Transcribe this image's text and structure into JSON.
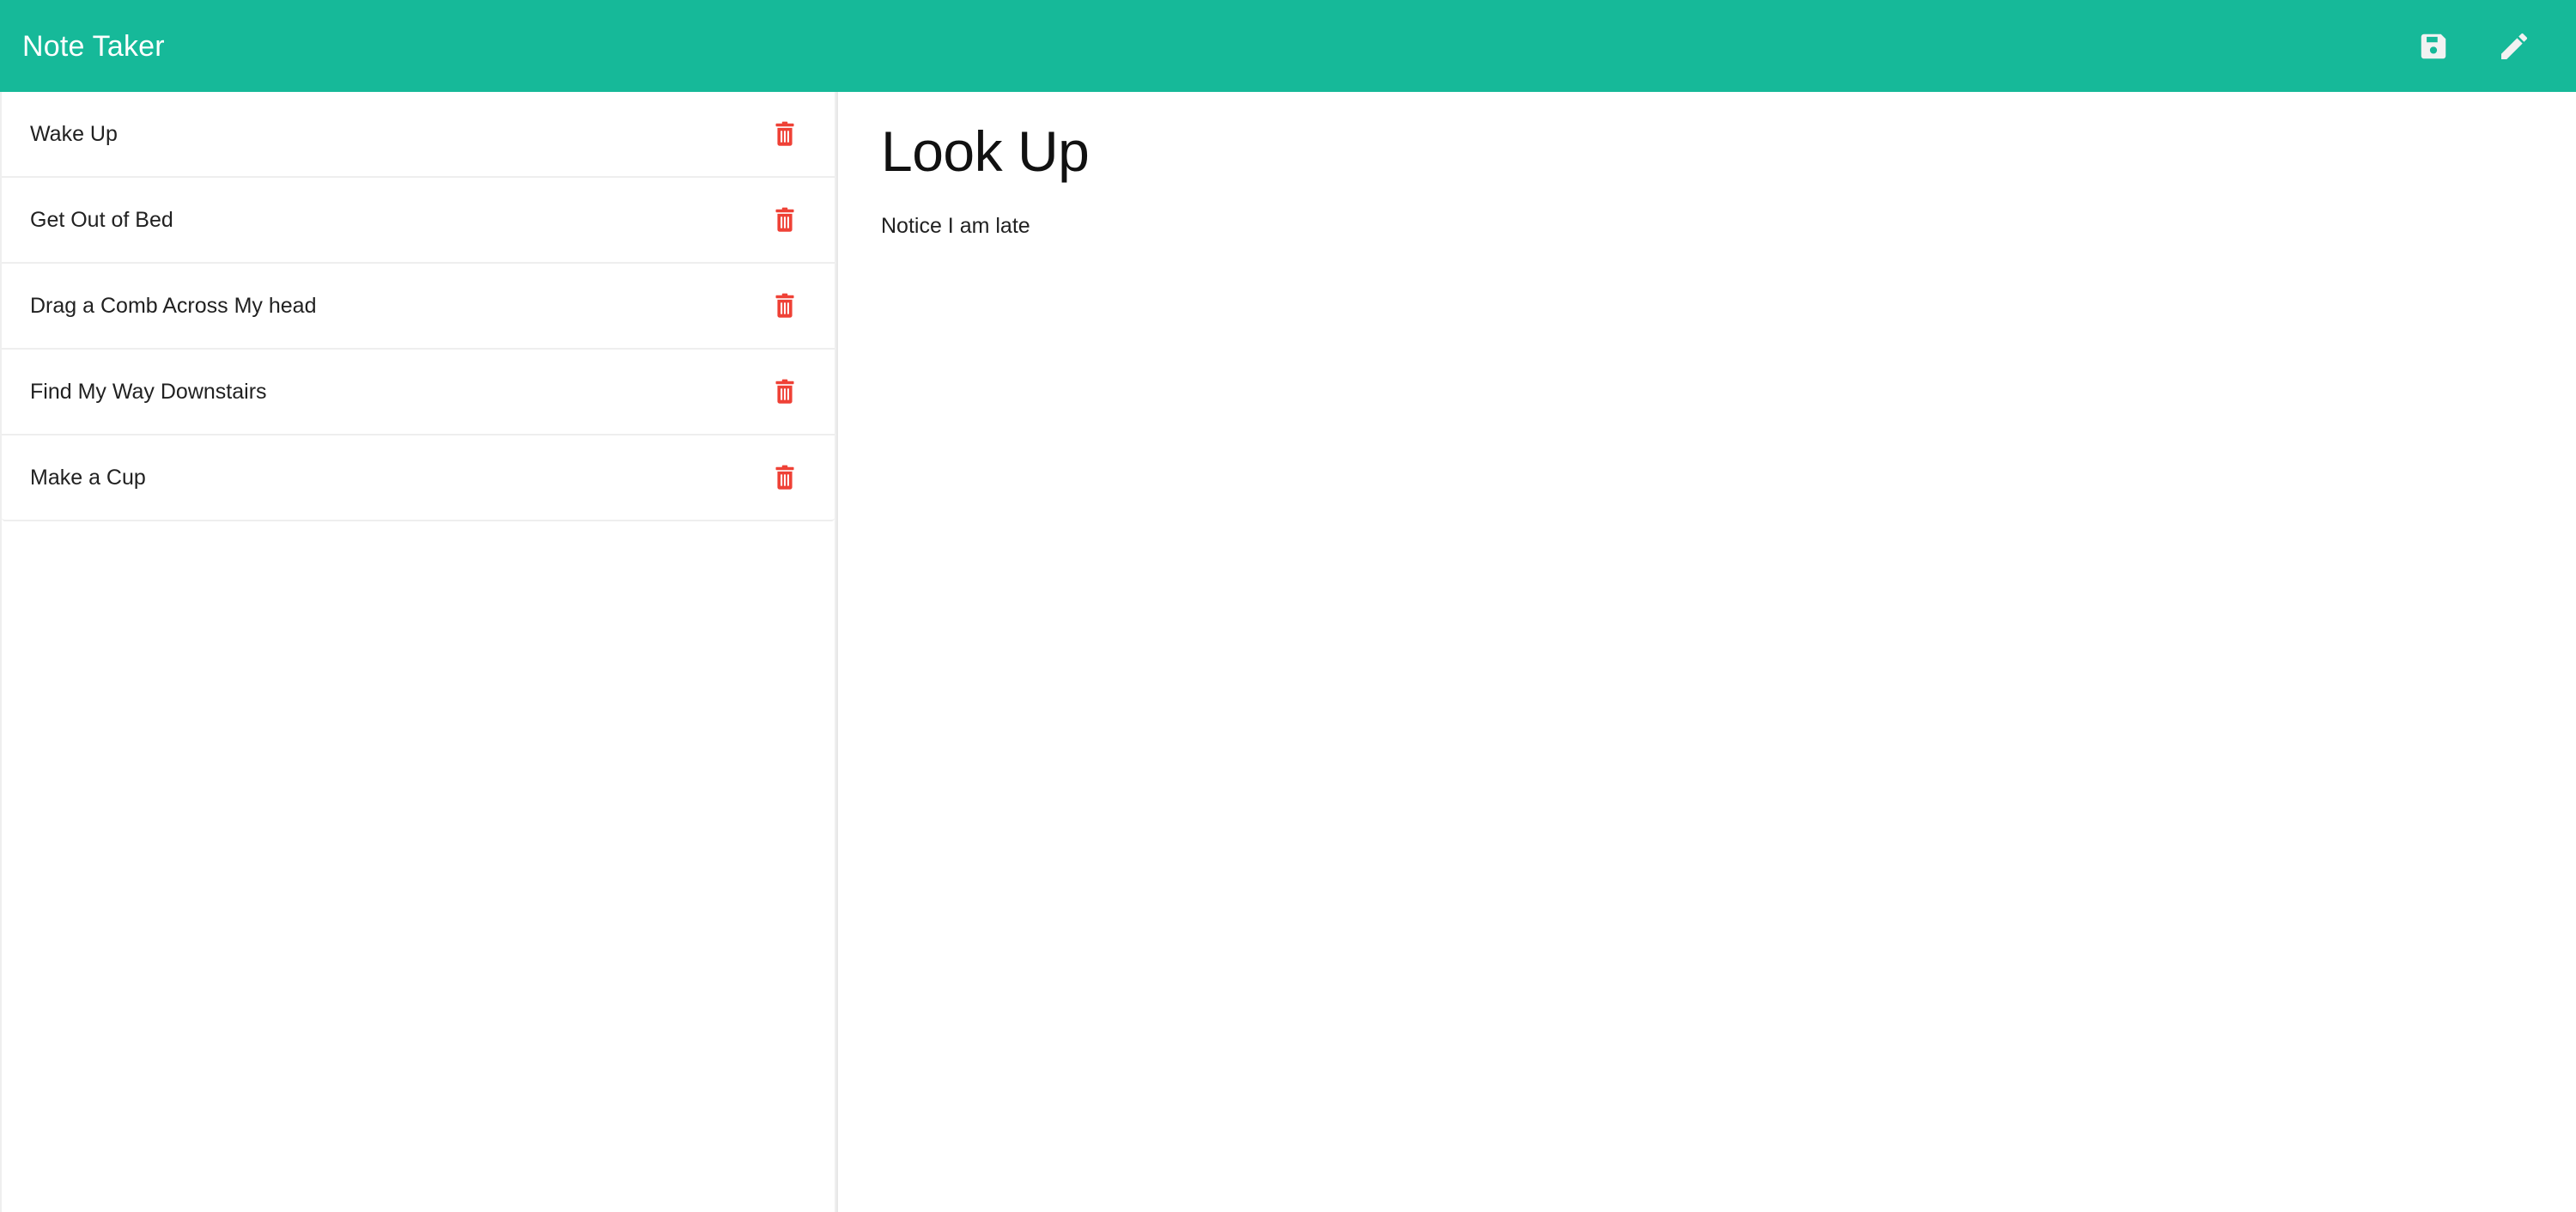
{
  "header": {
    "title": "Note Taker",
    "brand_color": "#16b999",
    "title_color": "#ffffff",
    "actions": [
      {
        "name": "save-button",
        "icon": "save-icon",
        "label": "Save"
      },
      {
        "name": "edit-button",
        "icon": "pencil-icon",
        "label": "Edit"
      }
    ]
  },
  "sidebar": {
    "delete_icon": "trash-icon",
    "delete_color": "#ef4136",
    "notes": [
      {
        "title": "Wake Up"
      },
      {
        "title": "Get Out of Bed"
      },
      {
        "title": "Drag a Comb Across My head"
      },
      {
        "title": "Find My Way Downstairs"
      },
      {
        "title": "Make a Cup"
      }
    ]
  },
  "note_detail": {
    "title": "Look Up",
    "body": "Notice I am late"
  }
}
